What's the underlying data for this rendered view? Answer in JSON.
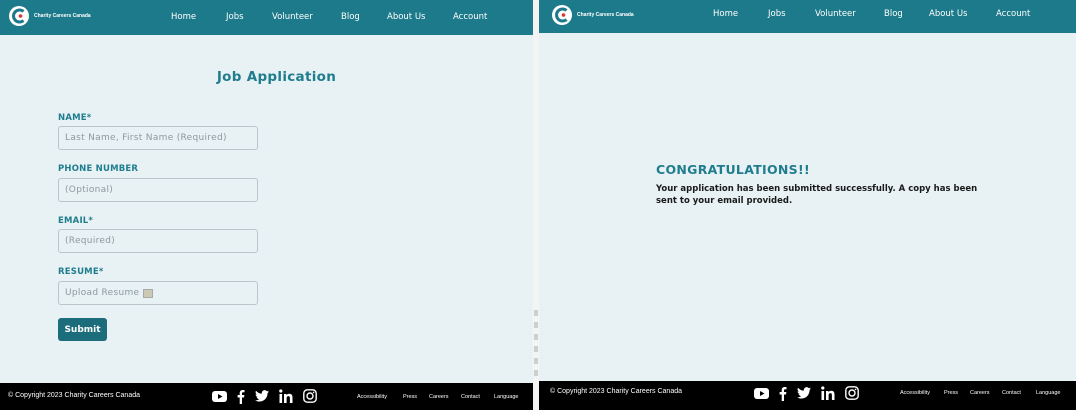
{
  "brand": {
    "name": "Charity Careers Canada",
    "header_color": "#1d7a8a",
    "accent_color": "#1f7d8e",
    "background_color": "#e8f1f4",
    "button_color": "#1c6d7c"
  },
  "nav": {
    "home": "Home",
    "jobs": "Jobs",
    "volunteer": "Volunteer",
    "blog": "Blog",
    "about": "About Us",
    "account": "Account"
  },
  "form": {
    "title": "Job Application",
    "name_label": "NAME*",
    "name_placeholder": "Last Name, First Name (Required)",
    "phone_label": "PHONE NUMBER",
    "phone_placeholder": "(Optional)",
    "email_label": "EMAIL*",
    "email_placeholder": "(Required)",
    "resume_label": "RESUME*",
    "resume_placeholder": "Upload Resume",
    "submit_label": "Submit"
  },
  "confirmation": {
    "heading": "CONGRATULATIONS!!",
    "message": "Your application has been submitted successfully. A copy has been sent to your email provided."
  },
  "footer": {
    "copyright": "© Copyright 2023 Charity Careers Canada",
    "social_icons": [
      "youtube-icon",
      "facebook-icon",
      "twitter-icon",
      "linkedin-icon",
      "instagram-icon"
    ],
    "links": {
      "accessibility": "Accessibility",
      "press": "Press",
      "careers": "Careers",
      "contact": "Contact",
      "language": "Language"
    }
  }
}
